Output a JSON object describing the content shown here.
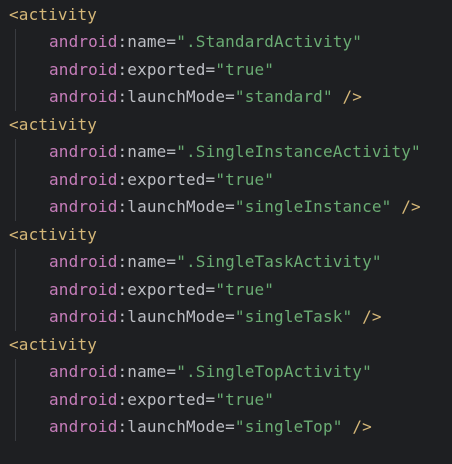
{
  "editor": {
    "blocks": [
      {
        "tag": "<activity",
        "attributes": [
          {
            "ns": "android",
            "sep": ":",
            "name": "name",
            "eq": "=",
            "value": "\".StandardActivity\"",
            "close": ""
          },
          {
            "ns": "android",
            "sep": ":",
            "name": "exported",
            "eq": "=",
            "value": "\"true\"",
            "close": ""
          },
          {
            "ns": "android",
            "sep": ":",
            "name": "launchMode",
            "eq": "=",
            "value": "\"standard\"",
            "close": " />"
          }
        ]
      },
      {
        "tag": "<activity",
        "attributes": [
          {
            "ns": "android",
            "sep": ":",
            "name": "name",
            "eq": "=",
            "value": "\".SingleInstanceActivity\"",
            "close": ""
          },
          {
            "ns": "android",
            "sep": ":",
            "name": "exported",
            "eq": "=",
            "value": "\"true\"",
            "close": ""
          },
          {
            "ns": "android",
            "sep": ":",
            "name": "launchMode",
            "eq": "=",
            "value": "\"singleInstance\"",
            "close": " />"
          }
        ]
      },
      {
        "tag": "<activity",
        "attributes": [
          {
            "ns": "android",
            "sep": ":",
            "name": "name",
            "eq": "=",
            "value": "\".SingleTaskActivity\"",
            "close": ""
          },
          {
            "ns": "android",
            "sep": ":",
            "name": "exported",
            "eq": "=",
            "value": "\"true\"",
            "close": ""
          },
          {
            "ns": "android",
            "sep": ":",
            "name": "launchMode",
            "eq": "=",
            "value": "\"singleTask\"",
            "close": " />"
          }
        ]
      },
      {
        "tag": "<activity",
        "attributes": [
          {
            "ns": "android",
            "sep": ":",
            "name": "name",
            "eq": "=",
            "value": "\".SingleTopActivity\"",
            "close": ""
          },
          {
            "ns": "android",
            "sep": ":",
            "name": "exported",
            "eq": "=",
            "value": "\"true\"",
            "close": ""
          },
          {
            "ns": "android",
            "sep": ":",
            "name": "launchMode",
            "eq": "=",
            "value": "\"singleTop\"",
            "close": " />"
          }
        ]
      }
    ]
  },
  "colors": {
    "background": "#1e1f22",
    "tag": "#d5b778",
    "namespace": "#c77dbb",
    "attribute": "#bcbec4",
    "string": "#6aab73",
    "indent_guide": "#393b40"
  }
}
